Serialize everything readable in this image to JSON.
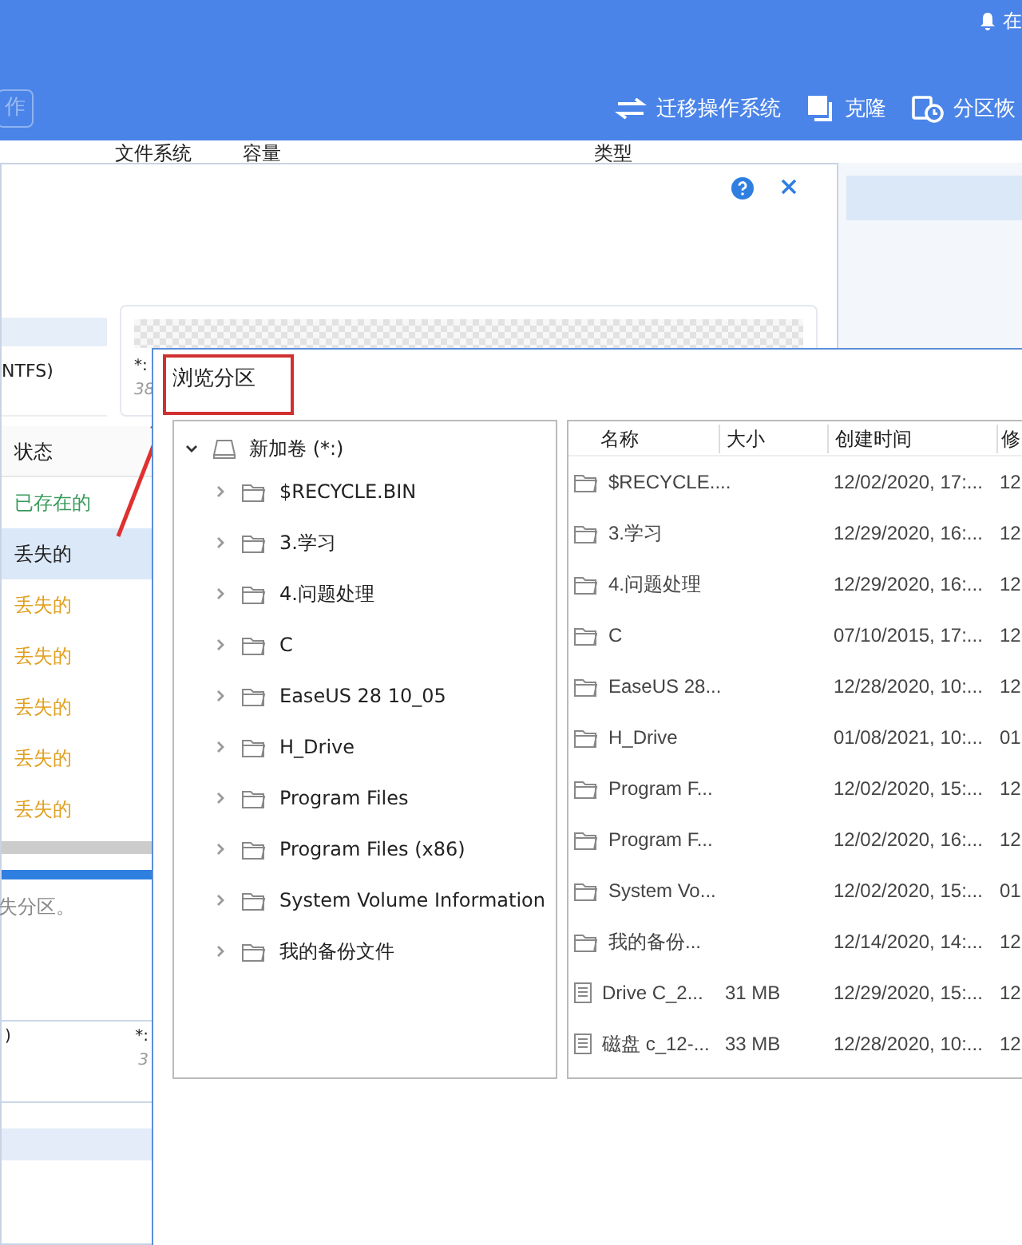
{
  "app": {
    "online": "在",
    "left_button": "作",
    "toolbar": [
      {
        "kind": "migrate",
        "label": "迁移操作系统"
      },
      {
        "kind": "clone",
        "label": "克隆"
      },
      {
        "kind": "recover",
        "label": "分区恢"
      }
    ],
    "columns": [
      "文件系统",
      "容量",
      "类型"
    ]
  },
  "scan_dialog": {
    "partition_card": {
      "label": "NTFS)"
    },
    "found_card": {
      "label": "*:",
      "size": "38"
    },
    "status_header": "状态",
    "rows": [
      {
        "status": "已存在的",
        "kind": "existing",
        "selected": false
      },
      {
        "status": "丢失的",
        "kind": "lost",
        "selected": true
      },
      {
        "status": "丢失的",
        "kind": "lost",
        "selected": false
      },
      {
        "status": "丢失的",
        "kind": "lost",
        "selected": false
      },
      {
        "status": "丢失的",
        "kind": "lost",
        "selected": false
      },
      {
        "status": "丢失的",
        "kind": "lost",
        "selected": false
      },
      {
        "status": "丢失的",
        "kind": "lost",
        "selected": false
      }
    ],
    "hint": "失分区。",
    "bottom_card": {
      "label": ")",
      "drive": "*:",
      "size": "3"
    }
  },
  "browse_dialog": {
    "title": "浏览分区",
    "tree": {
      "label": "新加卷 (*:)",
      "expanded": true,
      "children": [
        {
          "label": "$RECYCLE.BIN",
          "expanded": false
        },
        {
          "label": "3.学习",
          "expanded": false
        },
        {
          "label": "4.问题处理",
          "expanded": false
        },
        {
          "label": "C",
          "expanded": false
        },
        {
          "label": "EaseUS 28 10_05",
          "expanded": false
        },
        {
          "label": "H_Drive",
          "expanded": false
        },
        {
          "label": "Program Files",
          "expanded": false
        },
        {
          "label": "Program Files (x86)",
          "expanded": false
        },
        {
          "label": "System Volume Information",
          "expanded": false
        },
        {
          "label": "我的备份文件",
          "expanded": false
        }
      ]
    },
    "columns": [
      "名称",
      "大小",
      "创建时间",
      "修"
    ],
    "files": [
      {
        "kind": "folder",
        "name": "$RECYCLE....",
        "created": "12/02/2020, 17:...",
        "modified": "12"
      },
      {
        "kind": "folder",
        "name": "3.学习",
        "created": "12/29/2020, 16:...",
        "modified": "12"
      },
      {
        "kind": "folder",
        "name": "4.问题处理",
        "created": "12/29/2020, 16:...",
        "modified": "12"
      },
      {
        "kind": "folder",
        "name": "C",
        "created": "07/10/2015, 17:...",
        "modified": "12"
      },
      {
        "kind": "folder",
        "name": "EaseUS 28...",
        "created": "12/28/2020, 10:...",
        "modified": "12"
      },
      {
        "kind": "folder",
        "name": "H_Drive",
        "created": "01/08/2021, 10:...",
        "modified": "01"
      },
      {
        "kind": "folder",
        "name": "Program F...",
        "created": "12/02/2020, 15:...",
        "modified": "12"
      },
      {
        "kind": "folder",
        "name": "Program F...",
        "created": "12/02/2020, 16:...",
        "modified": "12"
      },
      {
        "kind": "folder",
        "name": "System Vo...",
        "created": "12/02/2020, 15:...",
        "modified": "01"
      },
      {
        "kind": "folder",
        "name": "我的备份...",
        "created": "12/14/2020, 14:...",
        "modified": "12"
      },
      {
        "kind": "file",
        "name": "Drive  C_2...",
        "size": "31 MB",
        "created": "12/29/2020, 15:...",
        "modified": "12"
      },
      {
        "kind": "file",
        "name": "磁盘 c_12-...",
        "size": "33 MB",
        "created": "12/28/2020, 10:...",
        "modified": "12"
      }
    ]
  }
}
